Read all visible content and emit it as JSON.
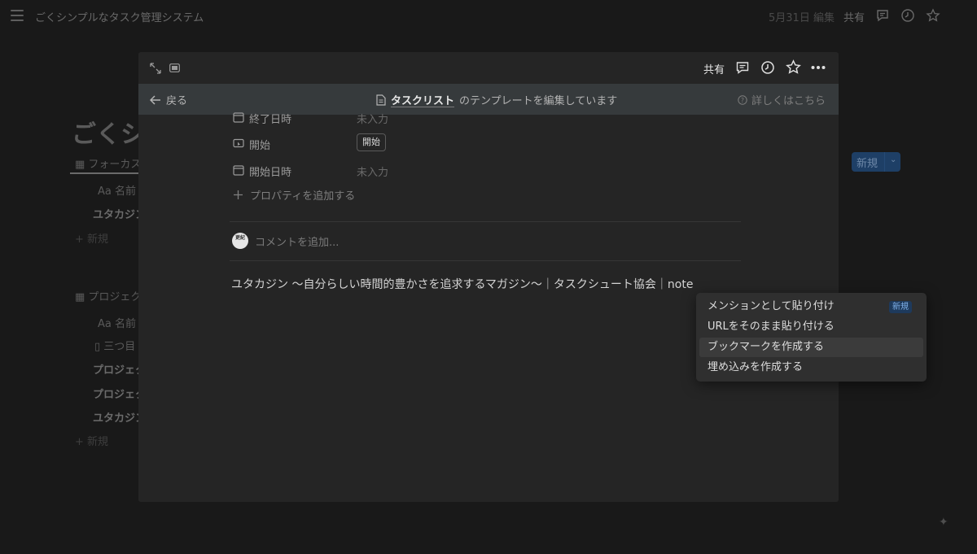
{
  "background": {
    "page_title": "ごくシンプルなタスク管理システム",
    "edited": "5月31日 編集",
    "share_label": "共有",
    "heading": "ごくシ",
    "view1_tab": "フォーカス",
    "name_col1": "Aa 名前",
    "row_yutaka1": "ユタカジン",
    "new_row1": "+ 新規",
    "view2_tab": "プロジェク",
    "name_col2": "Aa 名前",
    "row_mitsume": "三つ目",
    "row_project1": "プロジェク",
    "row_project2": "プロジェク",
    "row_yutaka2": "ユタカジン",
    "new_row2": "+ 新規",
    "new_button": "新規"
  },
  "modal": {
    "share_label": "共有",
    "back_label": "戻る",
    "template_page": "タスクリスト",
    "template_suffix": "のテンプレートを編集しています",
    "help_label": "詳しくはこちら",
    "properties": [
      {
        "label": "終了日時",
        "value": "未入力"
      },
      {
        "label": "開始",
        "value": "開始"
      },
      {
        "label": "開始日時",
        "value": "未入力"
      }
    ],
    "add_property": "プロパティを追加する",
    "avatar_text": "更紀",
    "comment_placeholder": "コメントを追加...",
    "pasted_link": "ユタカジン 〜自分らしい時間的豊かさを追求するマガジン〜｜タスクシュート協会｜note"
  },
  "paste_menu": {
    "items": [
      {
        "label": "メンションとして貼り付け",
        "badge": "新規"
      },
      {
        "label": "URLをそのまま貼り付ける"
      },
      {
        "label": "ブックマークを作成する"
      },
      {
        "label": "埋め込みを作成する"
      }
    ],
    "highlighted_index": 2
  }
}
